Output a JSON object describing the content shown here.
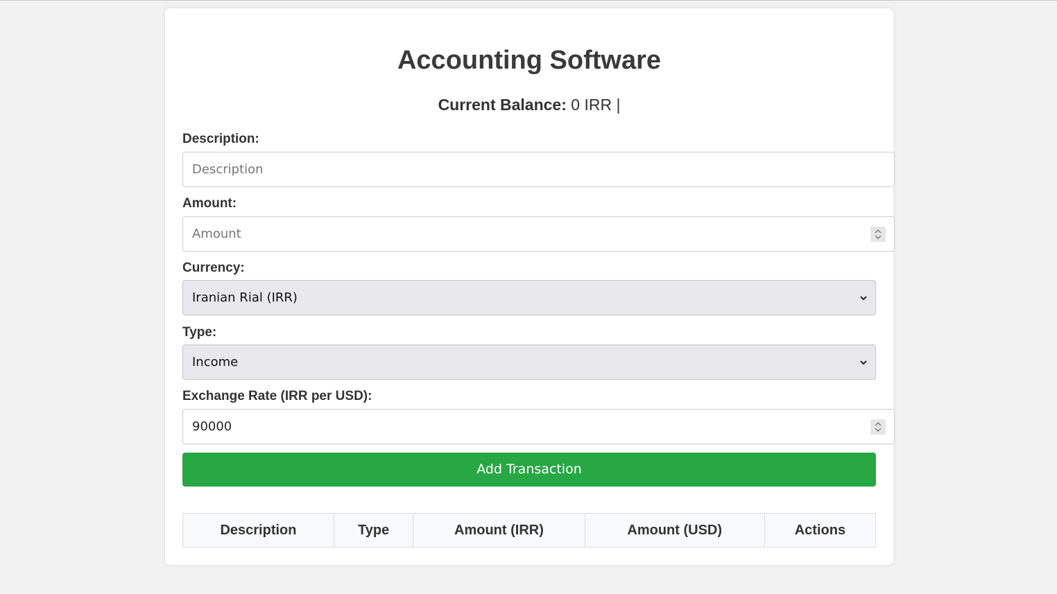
{
  "app": {
    "title": "Accounting Software"
  },
  "balance": {
    "label": "Current Balance:",
    "value": "0 IRR |"
  },
  "form": {
    "description": {
      "label": "Description:",
      "placeholder": "Description",
      "value": ""
    },
    "amount": {
      "label": "Amount:",
      "placeholder": "Amount",
      "value": ""
    },
    "currency": {
      "label": "Currency:",
      "selected": "Iranian Rial (IRR)"
    },
    "type": {
      "label": "Type:",
      "selected": "Income"
    },
    "exchange_rate": {
      "label": "Exchange Rate (IRR per USD):",
      "value": "90000"
    },
    "submit_label": "Add Transaction"
  },
  "table": {
    "columns": [
      "Description",
      "Type",
      "Amount (IRR)",
      "Amount (USD)",
      "Actions"
    ],
    "rows": []
  },
  "colors": {
    "accent": "#28a745",
    "background": "#f2f2f2",
    "card": "#ffffff"
  },
  "icons": {
    "select_arrow": "chevron-down-icon",
    "number_stepper": "spinner-arrows-icon"
  }
}
